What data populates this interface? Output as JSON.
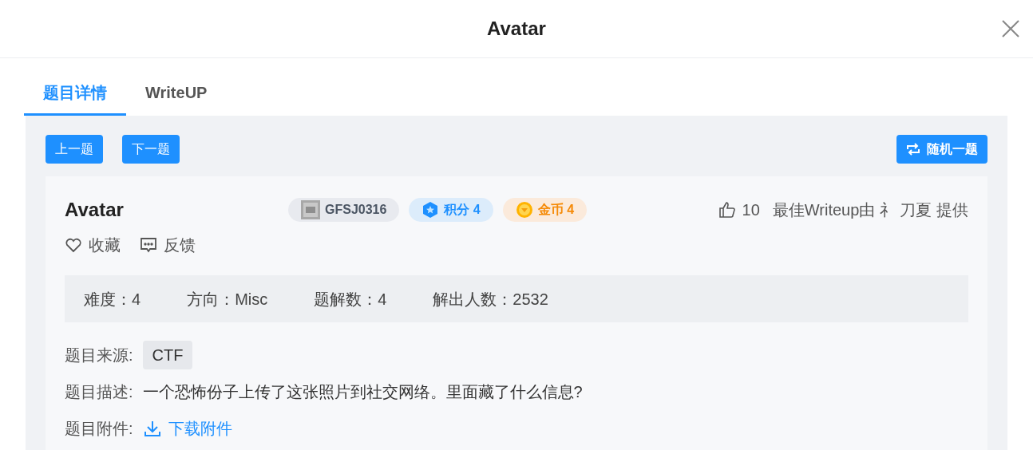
{
  "dialog": {
    "title": "Avatar"
  },
  "tabs": [
    {
      "label": "题目详情",
      "selected": true
    },
    {
      "label": "WriteUP",
      "selected": false
    }
  ],
  "nav_buttons": [
    "上一题",
    "下一题"
  ],
  "random_button": "随机一题",
  "challenge": {
    "title": "Avatar",
    "badges": [
      {
        "kind": "id",
        "text": "GFSJ0316"
      },
      {
        "kind": "score",
        "text": "积分 4"
      },
      {
        "kind": "coin",
        "text": "金币 4"
      }
    ],
    "likes": "10",
    "writeup_credit": "最佳Writeup由 礻 刀夏 提供",
    "actions": [
      {
        "kind": "favorite",
        "label": "收藏"
      },
      {
        "kind": "feedback",
        "label": "反馈"
      }
    ],
    "stats": [
      "难度：4",
      "方向：Misc",
      "题解数：4",
      "解出人数：2532"
    ],
    "source": {
      "label": "题目来源:",
      "value": "CTF"
    },
    "description": {
      "label": "题目描述:",
      "value": "一个恐怖份子上传了这张照片到社交网络。里面藏了什么信息?"
    },
    "attachment": {
      "label": "题目附件:",
      "link": "下载附件"
    }
  }
}
